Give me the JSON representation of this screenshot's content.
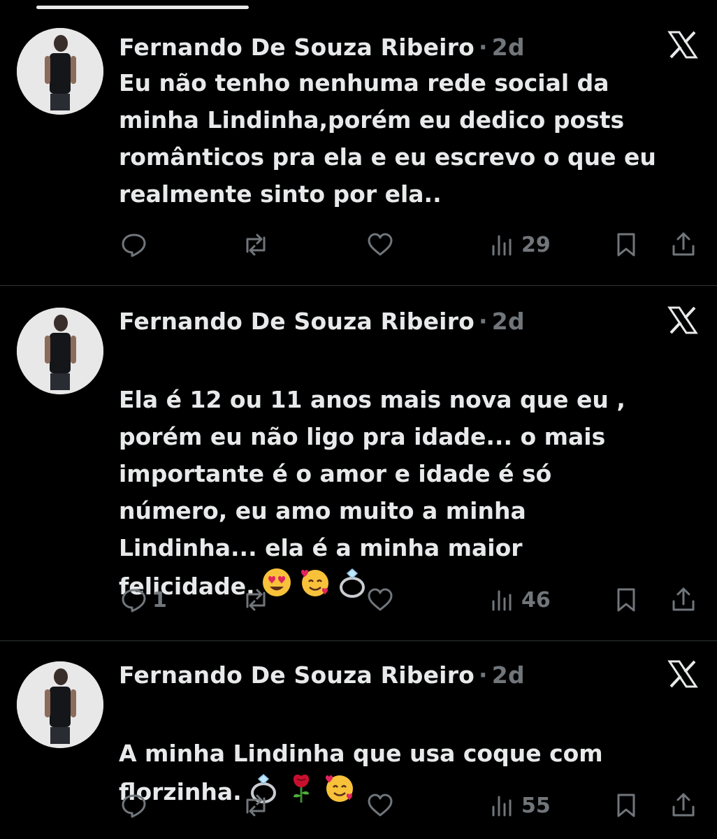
{
  "colors": {
    "background": "#000000",
    "text_primary": "#e7e9ea",
    "text_secondary": "#71767b",
    "divider": "#2f3336"
  },
  "posts": [
    {
      "author": "Fernando De Souza Ribeiro",
      "separator": "·",
      "time": "2d",
      "text": "Eu não tenho nenhuma rede social da\nminha Lindinha,porém eu dedico posts\nromânticos pra ela e eu escrevo o que eu\nrealmente sinto por ela..",
      "emojis": [],
      "replies": "",
      "views": "29",
      "icons": [
        "reply-icon",
        "repost-icon",
        "like-icon",
        "views-icon",
        "bookmark-icon",
        "share-icon",
        "close-icon"
      ]
    },
    {
      "author": "Fernando De Souza Ribeiro",
      "separator": "·",
      "time": "2d",
      "text": "Ela é 12 ou 11 anos mais nova que eu ,\nporém eu não ligo pra idade... o mais\nimportante é o amor e idade é só\nnúmero,  eu amo muito a minha\nLindinha... ela é a minha maior\nfelicidade.",
      "emojis": [
        "heart-eyes-emoji",
        "smiling-hearts-emoji",
        "ring-emoji"
      ],
      "replies": "1",
      "views": "46",
      "icons": [
        "reply-icon",
        "repost-icon",
        "like-icon",
        "views-icon",
        "bookmark-icon",
        "share-icon",
        "close-icon"
      ]
    },
    {
      "author": "Fernando De Souza Ribeiro",
      "separator": "·",
      "time": "2d",
      "text": "A minha Lindinha que usa coque com\nflorzinha.",
      "emojis": [
        "ring-emoji",
        "rose-emoji",
        "smiling-hearts-emoji"
      ],
      "replies": "",
      "views": "55",
      "icons": [
        "reply-icon",
        "repost-icon",
        "like-icon",
        "views-icon",
        "bookmark-icon",
        "share-icon",
        "close-icon"
      ]
    }
  ]
}
